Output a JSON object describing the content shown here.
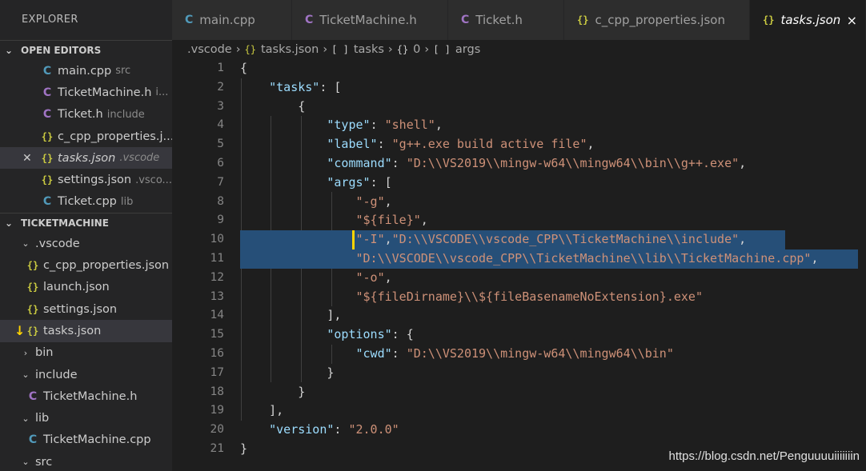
{
  "sidebar": {
    "title": "EXPLORER",
    "open_editors_header": "OPEN EDITORS",
    "open_editors": [
      {
        "icon": "C",
        "name": "main.cpp",
        "desc": "src"
      },
      {
        "icon": "C",
        "name": "TicketMachine.h",
        "desc": "i..."
      },
      {
        "icon": "C",
        "name": "Ticket.h",
        "desc": "include"
      },
      {
        "icon": "{}",
        "name": "c_cpp_properties.j...",
        "desc": ""
      },
      {
        "icon": "{}",
        "name": "tasks.json",
        "desc": ".vscode"
      },
      {
        "icon": "{}",
        "name": "settings.json",
        "desc": ".vsco..."
      },
      {
        "icon": "C",
        "name": "Ticket.cpp",
        "desc": "lib"
      }
    ],
    "project_header": "TICKETMACHINE",
    "tree": [
      {
        "icon": "⌄",
        "name": ".vscode"
      },
      {
        "icon": "{}",
        "name": "c_cpp_properties.json"
      },
      {
        "icon": "{}",
        "name": "launch.json"
      },
      {
        "icon": "{}",
        "name": "settings.json"
      },
      {
        "icon": "{}",
        "name": "tasks.json"
      },
      {
        "icon": "›",
        "name": "bin"
      },
      {
        "icon": "⌄",
        "name": "include"
      },
      {
        "icon": "C",
        "name": "TicketMachine.h"
      },
      {
        "icon": "⌄",
        "name": "lib"
      },
      {
        "icon": "C",
        "name": "TicketMachine.cpp"
      },
      {
        "icon": "⌄",
        "name": "src"
      }
    ]
  },
  "tabs": [
    {
      "icon": "C",
      "label": "main.cpp"
    },
    {
      "icon": "C",
      "label": "TicketMachine.h"
    },
    {
      "icon": "C",
      "label": "Ticket.h"
    },
    {
      "icon": "{}",
      "label": "c_cpp_properties.json"
    },
    {
      "icon": "{}",
      "label": "tasks.json",
      "close": "×"
    }
  ],
  "breadcrumb": [
    ".vscode",
    "tasks.json",
    "tasks",
    "0",
    "args"
  ],
  "breadcrumb_icons": [
    "{}",
    "[ ]",
    "{}",
    "[ ]"
  ],
  "code": {
    "line_numbers": [
      "1",
      "2",
      "3",
      "4",
      "5",
      "6",
      "7",
      "8",
      "9",
      "10",
      "11",
      "12",
      "13",
      "14",
      "15",
      "16",
      "17",
      "18",
      "19",
      "20",
      "21"
    ],
    "l1": "{",
    "l2_key": "\"tasks\"",
    "l2_rest": ": [",
    "l3": "{",
    "l4_key": "\"type\"",
    "l4_val": "\"shell\"",
    "l5_key": "\"label\"",
    "l5_val": "\"g++.exe build active file\"",
    "l6_key": "\"command\"",
    "l6_val": "\"D:\\\\VS2019\\\\mingw-w64\\\\mingw64\\\\bin\\\\g++.exe\"",
    "l7_key": "\"args\"",
    "l7_rest": ": [",
    "l8_val": "\"-g\"",
    "l9_val": "\"${file}\"",
    "l10_a": "\"-I\"",
    "l10_b": "\"D:\\\\VSCODE\\\\vscode_CPP\\\\TicketMachine\\\\include\"",
    "l11_val": "\"D:\\\\VSCODE\\\\vscode_CPP\\\\TicketMachine\\\\lib\\\\TicketMachine.cpp\"",
    "l12_val": "\"-o\"",
    "l13_val": "\"${fileDirname}\\\\${fileBasenameNoExtension}.exe\"",
    "l14": "],",
    "l15_key": "\"options\"",
    "l15_rest": ": {",
    "l16_key": "\"cwd\"",
    "l16_val": "\"D:\\\\VS2019\\\\mingw-w64\\\\mingw64\\\\bin\"",
    "l17": "}",
    "l18": "}",
    "l19": "],",
    "l20_key": "\"version\"",
    "l20_val": "\"2.0.0\"",
    "l21": "}"
  },
  "watermark": "https://blog.csdn.net/Penguuuuiiiiiiin",
  "colors": {
    "accent_json": "#cbcb41",
    "c_header": "#a074c4",
    "cpp": "#519aba",
    "selection": "#264f78",
    "pointer": "#ffd400"
  }
}
